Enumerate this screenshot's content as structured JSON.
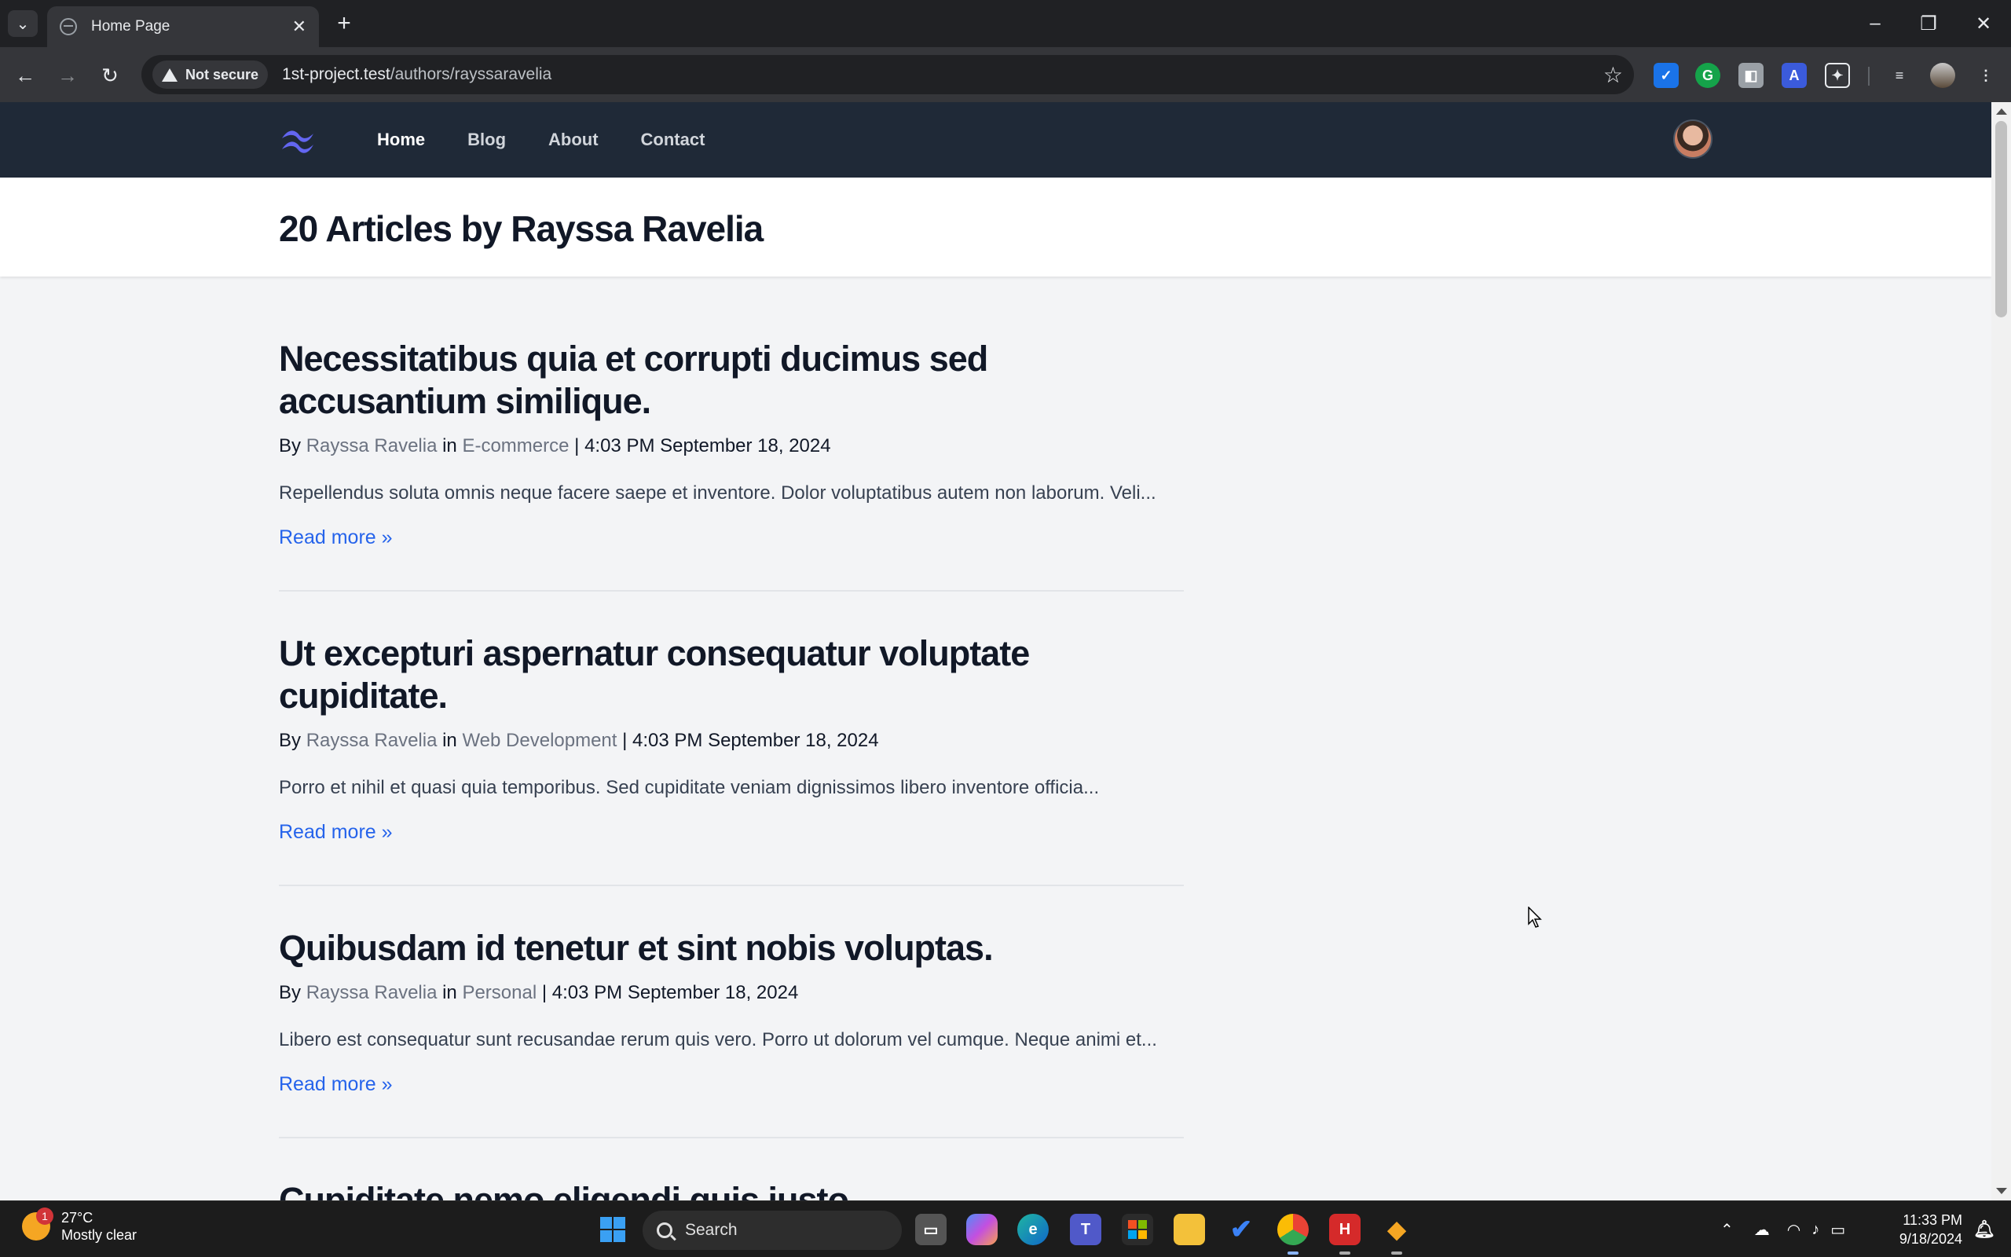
{
  "browser": {
    "tab_title": "Home Page",
    "security_label": "Not secure",
    "url_host": "1st-project.test",
    "url_path": "/authors/rayssaravelia"
  },
  "site": {
    "nav": [
      {
        "label": "Home",
        "active": true
      },
      {
        "label": "Blog",
        "active": false
      },
      {
        "label": "About",
        "active": false
      },
      {
        "label": "Contact",
        "active": false
      }
    ],
    "page_title": "20 Articles by Rayssa Ravelia"
  },
  "articles": [
    {
      "title": "Necessitatibus quia et corrupti ducimus sed accusantium similique.",
      "by": "By",
      "author": "Rayssa Ravelia",
      "in": "in",
      "category": "E-commerce",
      "time": "4:03 PM September 18, 2024",
      "excerpt": "Repellendus soluta omnis neque facere saepe et inventore. Dolor voluptatibus autem non laborum. Veli...",
      "read_more": "Read more »"
    },
    {
      "title": "Ut excepturi aspernatur consequatur voluptate cupiditate.",
      "by": "By",
      "author": "Rayssa Ravelia",
      "in": "in",
      "category": "Web Development",
      "time": "4:03 PM September 18, 2024",
      "excerpt": "Porro et nihil et quasi quia temporibus. Sed cupiditate veniam dignissimos libero inventore officia...",
      "read_more": "Read more »"
    },
    {
      "title": "Quibusdam id tenetur et sint nobis voluptas.",
      "by": "By",
      "author": "Rayssa Ravelia",
      "in": "in",
      "category": "Personal",
      "time": "4:03 PM September 18, 2024",
      "excerpt": "Libero est consequatur sunt recusandae rerum quis vero. Porro ut dolorum vel cumque. Neque animi et...",
      "read_more": "Read more »"
    },
    {
      "title": "Cupiditate nemo eligendi quis iusto."
    }
  ],
  "taskbar": {
    "weather_temp": "27°C",
    "weather_desc": "Mostly clear",
    "weather_badge": "1",
    "search_placeholder": "Search",
    "clock_time": "11:33 PM",
    "clock_date": "9/18/2024"
  },
  "colors": {
    "nav_bg": "#1f2937",
    "page_bg": "#f3f4f6",
    "link_blue": "#2563eb",
    "logo_accent": "#6366f1"
  }
}
